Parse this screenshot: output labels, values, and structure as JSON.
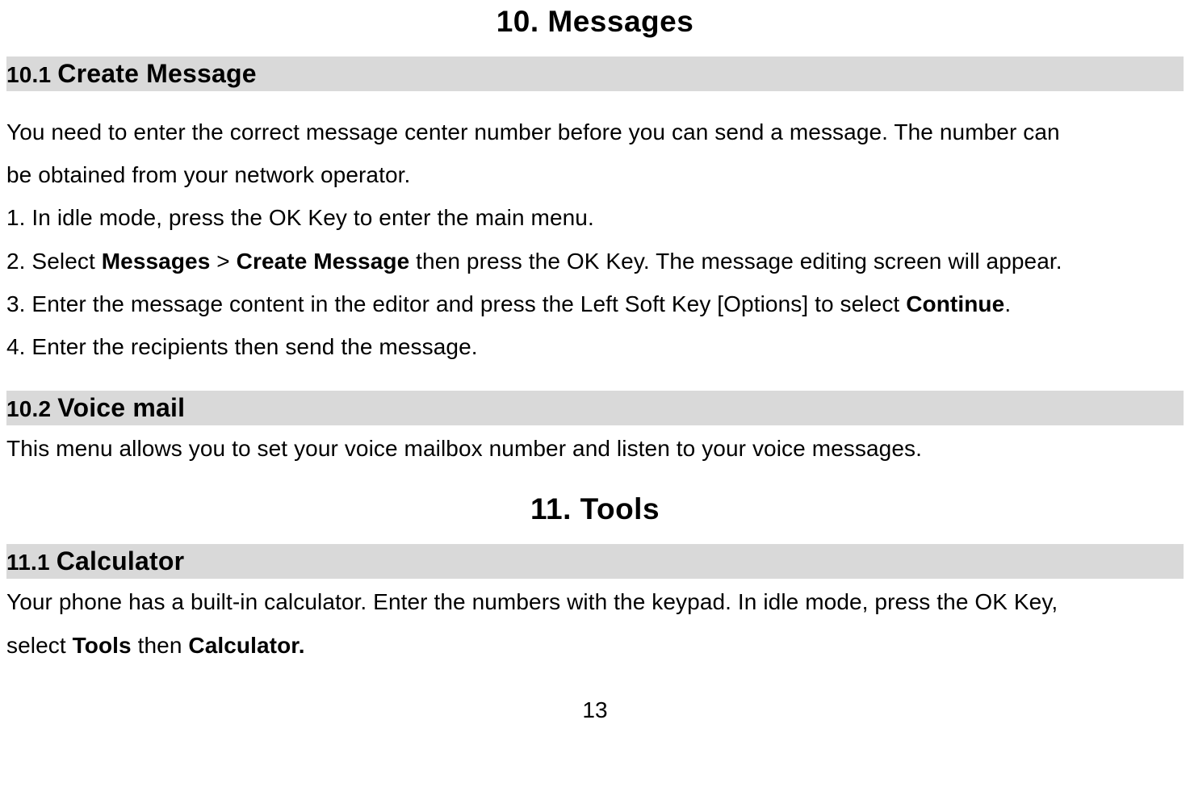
{
  "chapter10": {
    "title": "10. Messages",
    "sec1": {
      "num": "10.1 ",
      "title": "Create Message",
      "intro1": "You need to enter the correct message center number before you can send a message. The number can",
      "intro2": "be obtained from your network operator.",
      "step1": "1. In idle mode, press the OK Key to enter the main menu.",
      "step2a": "2. Select ",
      "step2b_bold": "Messages",
      "step2c": " > ",
      "step2d_bold": "Create Message",
      "step2e": " then press the OK Key. The message editing screen will appear.",
      "step3a": "3. Enter the message content in the editor and press the Left Soft Key [Options] to select ",
      "step3b_bold": "Continue",
      "step3c": ".",
      "step4": "4. Enter the recipients then send the message."
    },
    "sec2": {
      "num": "10.2 ",
      "title": "Voice mail",
      "body": "This menu allows you to set your voice mailbox number and listen to your voice messages."
    }
  },
  "chapter11": {
    "title": "11. Tools",
    "sec1": {
      "num": "11.1 ",
      "title": "Calculator",
      "body1": "Your phone has a built-in calculator. Enter the numbers with the keypad. In idle mode, press the OK Key,",
      "body2a": "select ",
      "body2b_bold": "Tools",
      "body2c": " then ",
      "body2d_bold": "Calculator."
    }
  },
  "pageNumber": "13"
}
